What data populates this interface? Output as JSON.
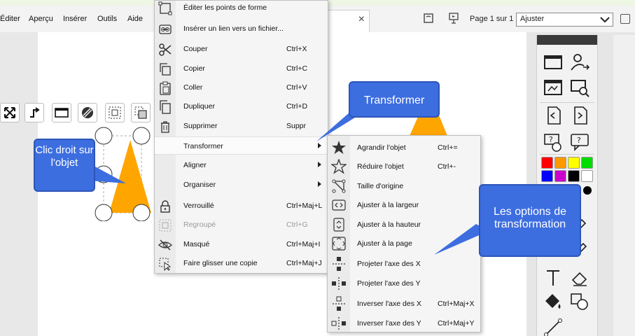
{
  "menubar": {
    "items": [
      "Éditer",
      "Aperçu",
      "Insérer",
      "Outils",
      "Aide"
    ]
  },
  "document_tab": {
    "close": "×"
  },
  "toolbar": {
    "page_label": "Page 1 sur 1",
    "zoom_value": "Ajuster"
  },
  "context_menu": {
    "items": [
      {
        "label": "Éditer les points de forme",
        "shortcut": "",
        "icon": "edit-points-icon"
      },
      {
        "label": "Insérer un lien vers un fichier...",
        "shortcut": "",
        "icon": "link-file-icon"
      },
      {
        "label": "Couper",
        "shortcut": "Ctrl+X",
        "icon": "scissors-icon"
      },
      {
        "label": "Copier",
        "shortcut": "Ctrl+C",
        "icon": "copy-icon"
      },
      {
        "label": "Coller",
        "shortcut": "Ctrl+V",
        "icon": "paste-icon"
      },
      {
        "label": "Dupliquer",
        "shortcut": "Ctrl+D",
        "icon": "duplicate-icon"
      },
      {
        "label": "Supprimer",
        "shortcut": "Suppr",
        "icon": "trash-icon"
      },
      {
        "label": "Transformer",
        "shortcut": "",
        "icon": "",
        "submenu": true,
        "highlighted": true
      },
      {
        "label": "Aligner",
        "shortcut": "",
        "icon": "",
        "submenu": true
      },
      {
        "label": "Organiser",
        "shortcut": "",
        "icon": "",
        "submenu": true
      },
      {
        "label": "Verrouillé",
        "shortcut": "Ctrl+Maj+L",
        "icon": "lock-icon"
      },
      {
        "label": "Regroupé",
        "shortcut": "Ctrl+G",
        "icon": "group-icon",
        "disabled": true
      },
      {
        "label": "Masqué",
        "shortcut": "Ctrl+Maj+I",
        "icon": "eye-hidden-icon"
      },
      {
        "label": "Faire glisser une copie",
        "shortcut": "Ctrl+Maj+J",
        "icon": "drag-copy-icon"
      }
    ]
  },
  "submenu": {
    "items": [
      {
        "label": "Agrandir l'objet",
        "shortcut": "Ctrl+=",
        "icon": "star-filled-icon"
      },
      {
        "label": "Réduire l'objet",
        "shortcut": "Ctrl+-",
        "icon": "star-outline-icon"
      },
      {
        "label": "Taille d'origine",
        "shortcut": "",
        "icon": "original-size-icon"
      },
      {
        "label": "Ajuster à la largeur",
        "shortcut": "",
        "icon": "fit-width-icon"
      },
      {
        "label": "Ajuster à la hauteur",
        "shortcut": "",
        "icon": "fit-height-icon"
      },
      {
        "label": "Ajuster à la page",
        "shortcut": "",
        "icon": "fit-page-icon"
      },
      {
        "label": "Projeter l'axe des X",
        "shortcut": "",
        "icon": "project-x-icon"
      },
      {
        "label": "Projeter l'axe des Y",
        "shortcut": "",
        "icon": "project-y-icon"
      },
      {
        "label": "Inverser l'axe des X",
        "shortcut": "Ctrl+Maj+X",
        "icon": "invert-x-icon"
      },
      {
        "label": "Inverser l'axe des Y",
        "shortcut": "Ctrl+Maj+Y",
        "icon": "invert-y-icon"
      }
    ]
  },
  "callouts": {
    "right_click": "Clic droit sur l'objet",
    "transform": "Transformer",
    "options": "Les options de transformation"
  },
  "colors": {
    "shape_fill": "#ffa500",
    "callout": "#3d6ee0",
    "swatches": [
      "#ff0000",
      "#ff9900",
      "#ffff00",
      "#00dd00",
      "#0000ff",
      "#cc00cc",
      "#000000",
      "#ffffff"
    ]
  }
}
